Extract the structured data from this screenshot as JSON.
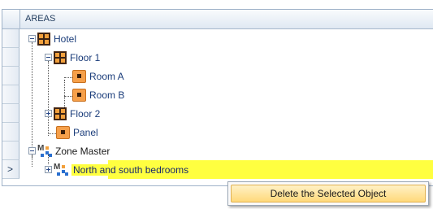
{
  "grid": {
    "header": "AREAS",
    "current_row_marker": ">"
  },
  "tree": {
    "hotel": "Hotel",
    "floor1": "Floor 1",
    "room_a": "Room A",
    "room_b": "Room B",
    "floor2": "Floor 2",
    "panel": "Panel",
    "zone_master": "Zone Master",
    "north_south": "North and south bedrooms"
  },
  "icons": {
    "area": "area-grid-icon",
    "room": "room-icon",
    "zone": "zone-master-icon"
  },
  "colors": {
    "selection": "#ffff40",
    "menu_hover": "#ffd97a"
  },
  "context_menu": {
    "delete_label": "Delete the Selected Object"
  }
}
